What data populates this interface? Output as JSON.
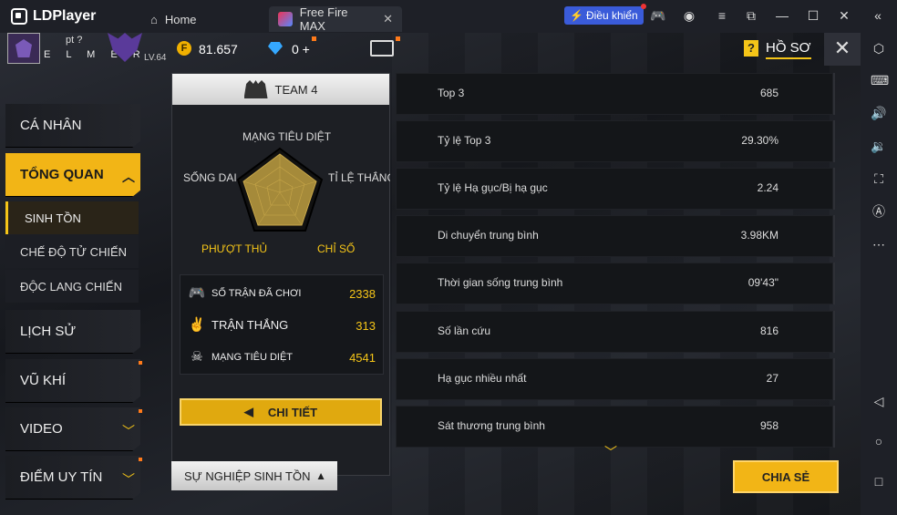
{
  "emulator": {
    "brand": "LDPlayer",
    "tabs": [
      {
        "label": "Home"
      },
      {
        "label": "Free Fire MAX"
      }
    ],
    "control_label": "Điều khiển"
  },
  "header": {
    "player_top": "pt ?",
    "player_name": "E L M E R",
    "level": "LV.64",
    "gold": "81.657",
    "diamonds": "0 +",
    "title": "HỒ SƠ"
  },
  "menu": {
    "items": [
      {
        "label": "CÁ NHÂN"
      },
      {
        "label": "TỔNG QUAN"
      },
      {
        "label": "LỊCH SỬ"
      },
      {
        "label": "VŨ KHÍ"
      },
      {
        "label": "VIDEO"
      },
      {
        "label": "ĐIỂM UY TÍN"
      }
    ],
    "sub": [
      {
        "label": "SINH TỒN"
      },
      {
        "label": "CHẾ ĐỘ TỬ CHIẾN"
      },
      {
        "label": "ĐỘC LANG CHIẾN"
      }
    ]
  },
  "team": {
    "title": "TEAM 4",
    "radar": {
      "top": "MẠNG TIÊU DIỆT",
      "left": "SỐNG DAI",
      "right": "TỈ LỆ THẮNG",
      "bottom_left": "PHƯỢT THỦ",
      "bottom_right": "CHỈ SỐ"
    },
    "stats": [
      {
        "label": "SỐ TRẬN ĐÃ CHƠI",
        "value": "2338"
      },
      {
        "label": "TRẬN THẮNG",
        "value": "313"
      },
      {
        "label": "MẠNG TIÊU DIỆT",
        "value": "4541"
      }
    ],
    "detail_label": "CHI TIẾT"
  },
  "details": [
    {
      "label": "Top 3",
      "value": "685"
    },
    {
      "label": "Tỷ lệ Top 3",
      "value": "29.30%"
    },
    {
      "label": "Tỷ lệ Hạ gục/Bị hạ gục",
      "value": "2.24"
    },
    {
      "label": "Di chuyển trung bình",
      "value": "3.98KM"
    },
    {
      "label": "Thời gian sống trung bình",
      "value": "09'43\""
    },
    {
      "label": "Số lần cứu",
      "value": "816"
    },
    {
      "label": "Hạ gục nhiều nhất",
      "value": "27"
    },
    {
      "label": "Sát thương trung bình",
      "value": "958"
    }
  ],
  "bottom": {
    "career_label": "SỰ NGHIỆP SINH TỒN",
    "share_label": "CHIA SẺ"
  },
  "colors": {
    "accent": "#f2b516",
    "dot": "#ff7a1a",
    "control": "#3a5bd9"
  }
}
